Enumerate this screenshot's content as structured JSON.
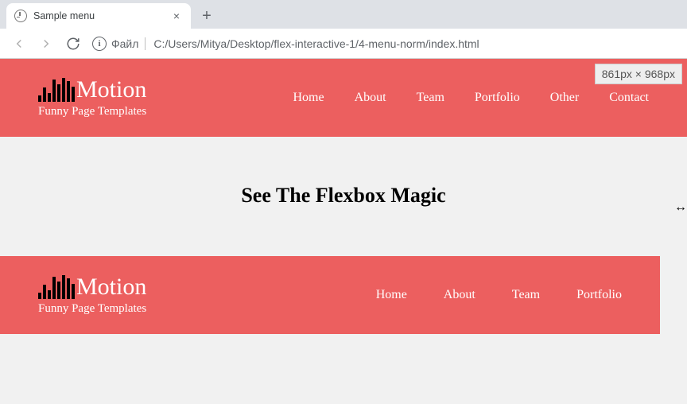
{
  "browser": {
    "tab_title": "Sample menu",
    "url_prefix": "Файл",
    "url_path": "C:/Users/Mitya/Desktop/flex-interactive-1/4-menu-norm/index.html",
    "dims_overlay": "861px × 968px"
  },
  "brand": {
    "name": "Motion",
    "tagline": "Funny Page Templates"
  },
  "nav_top": [
    {
      "label": "Home"
    },
    {
      "label": "About"
    },
    {
      "label": "Team"
    },
    {
      "label": "Portfolio"
    },
    {
      "label": "Other"
    },
    {
      "label": "Contact"
    }
  ],
  "hero": {
    "heading": "See The Flexbox Magic"
  },
  "nav_bottom": [
    {
      "label": "Home"
    },
    {
      "label": "About"
    },
    {
      "label": "Team"
    },
    {
      "label": "Portfolio"
    }
  ]
}
